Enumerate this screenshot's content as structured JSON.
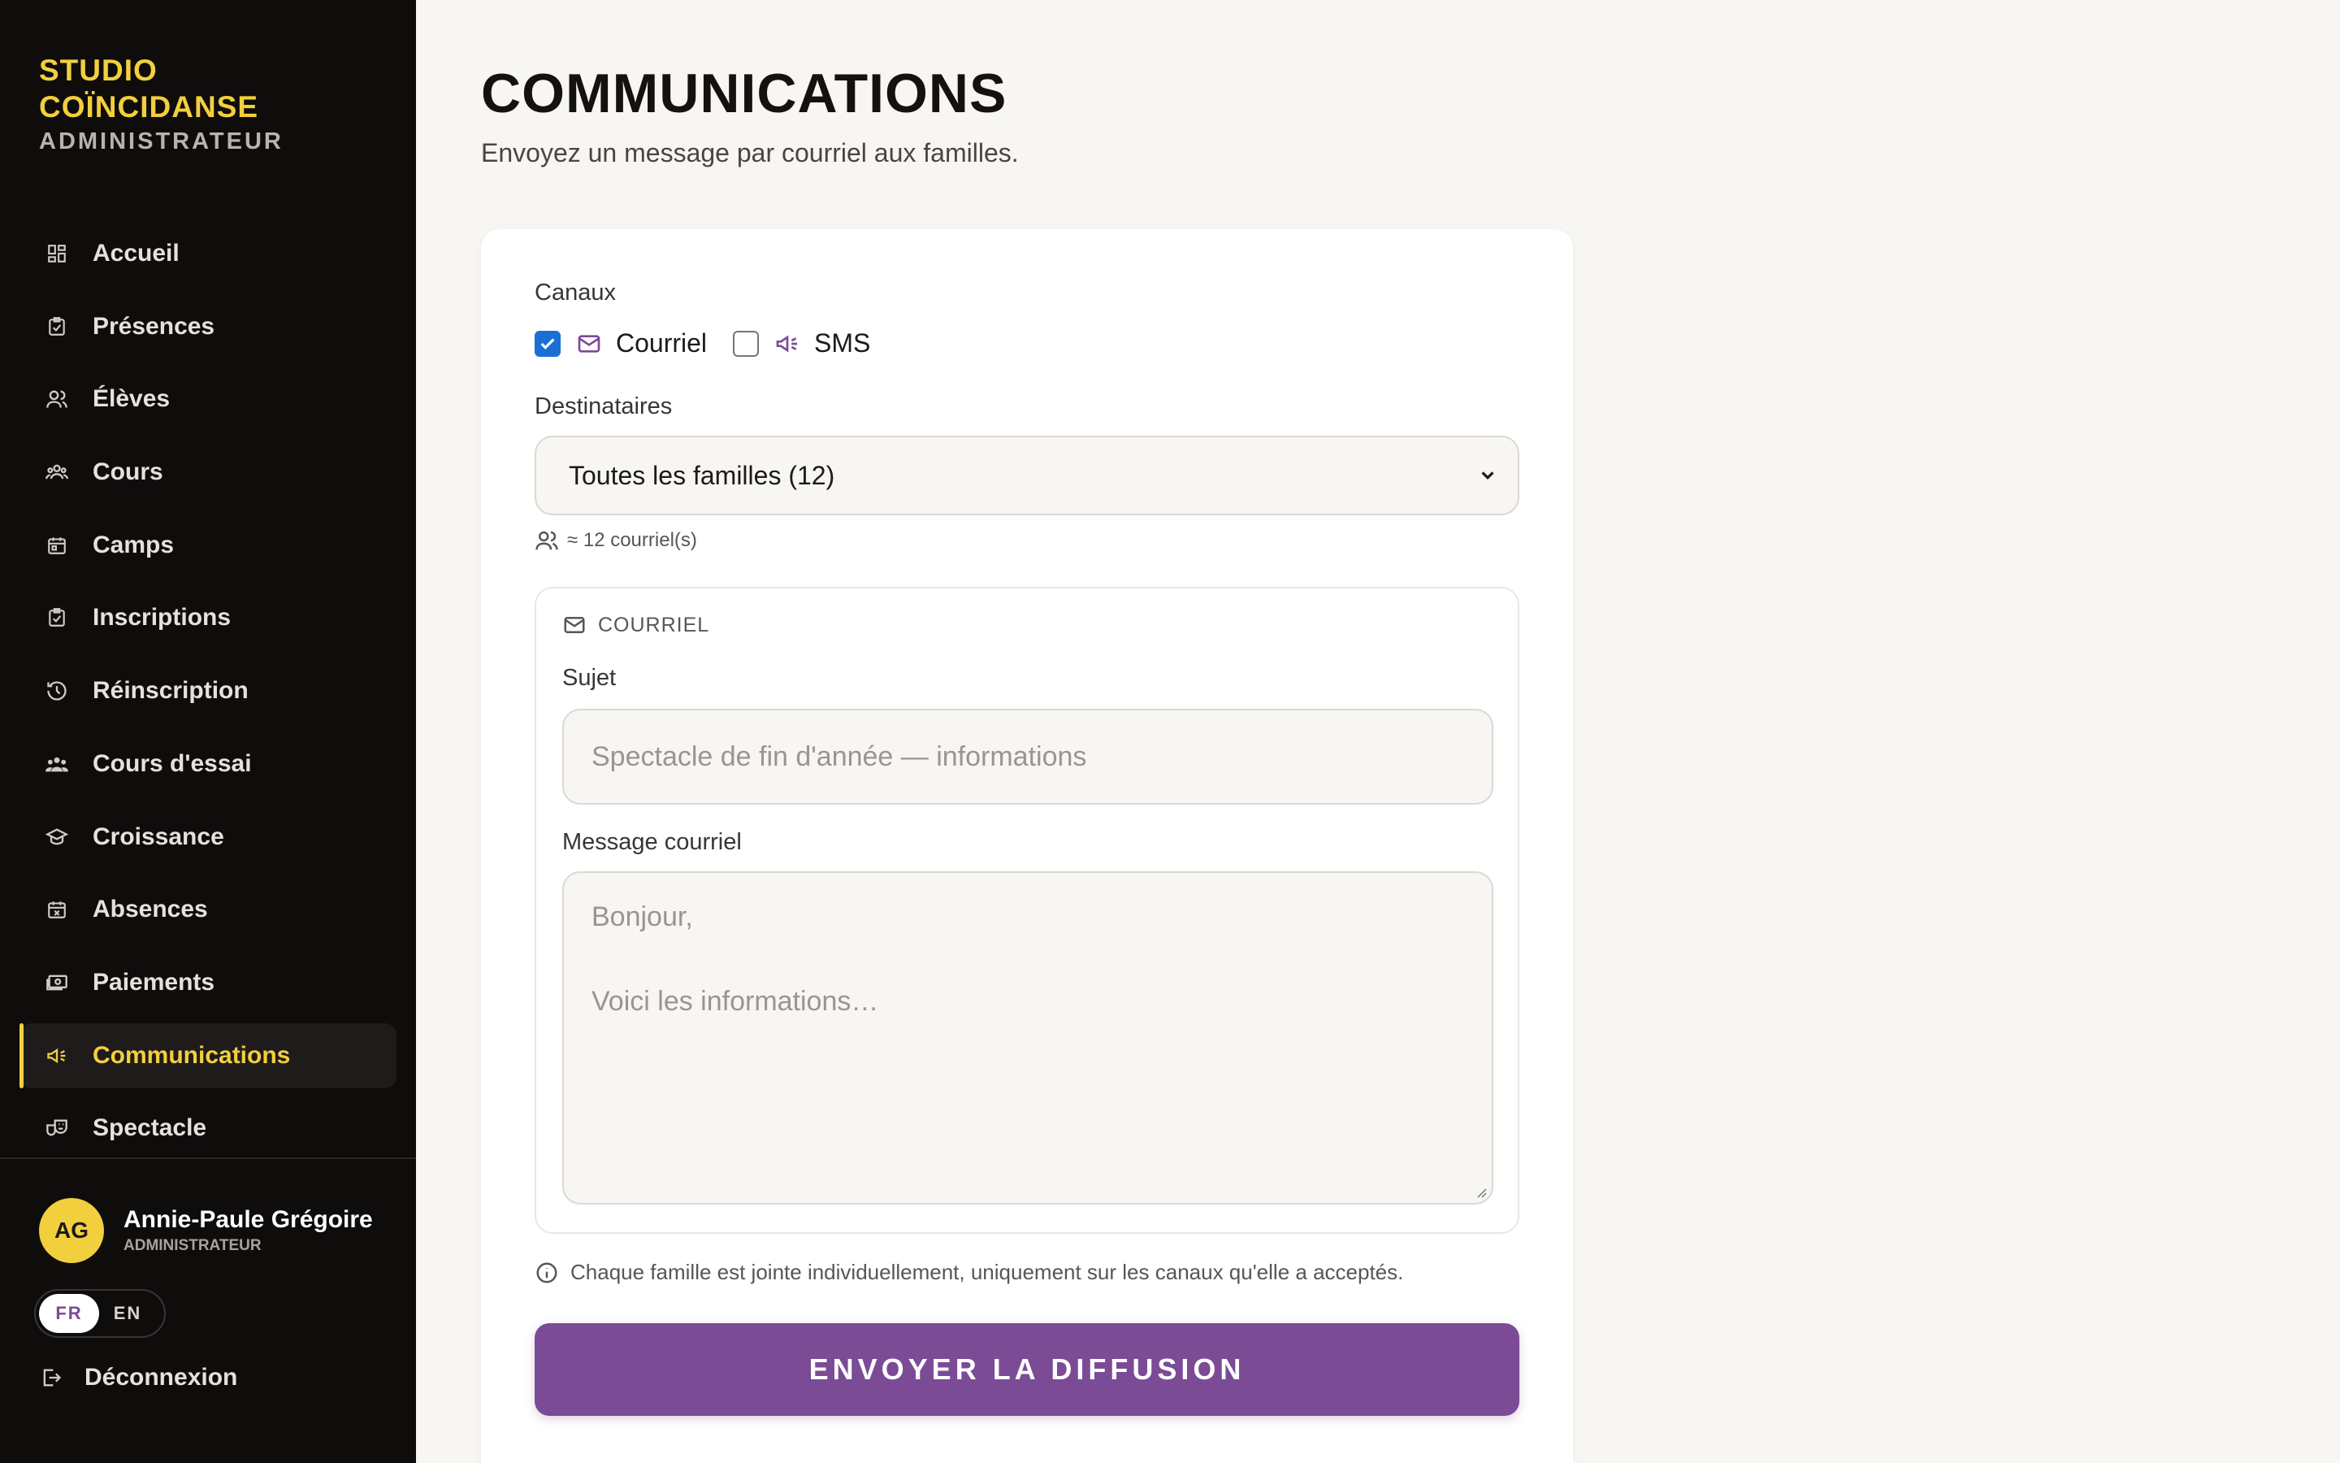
{
  "sidebar": {
    "brand_line1": "STUDIO",
    "brand_line2": "COÏNCIDANSE",
    "brand_role": "ADMINISTRATEUR",
    "items": [
      {
        "label": "Accueil",
        "icon": "dashboard-icon"
      },
      {
        "label": "Présences",
        "icon": "clipboard-check-icon"
      },
      {
        "label": "Élèves",
        "icon": "users-icon"
      },
      {
        "label": "Cours",
        "icon": "group-icon"
      },
      {
        "label": "Camps",
        "icon": "calendar-icon"
      },
      {
        "label": "Inscriptions",
        "icon": "clipboard-check-icon"
      },
      {
        "label": "Réinscription",
        "icon": "history-icon"
      },
      {
        "label": "Cours d'essai",
        "icon": "group-icon"
      },
      {
        "label": "Croissance",
        "icon": "graduation-cap-icon"
      },
      {
        "label": "Absences",
        "icon": "calendar-x-icon"
      },
      {
        "label": "Paiements",
        "icon": "money-icon"
      },
      {
        "label": "Communications",
        "icon": "megaphone-icon",
        "active": true
      },
      {
        "label": "Spectacle",
        "icon": "theater-masks-icon"
      }
    ],
    "user": {
      "initials": "AG",
      "name": "Annie-Paule Grégoire",
      "role": "ADMINISTRATEUR"
    },
    "lang": {
      "fr": "FR",
      "en": "EN",
      "active": "FR"
    },
    "logout": "Déconnexion"
  },
  "main": {
    "title": "COMMUNICATIONS",
    "subtitle": "Envoyez un message par courriel aux familles.",
    "channels": {
      "label": "Canaux",
      "email": {
        "label": "Courriel",
        "checked": true
      },
      "sms": {
        "label": "SMS",
        "checked": false
      }
    },
    "recipients": {
      "label": "Destinataires",
      "selected": "Toutes les familles (12)",
      "count": "≈ 12 courriel(s)"
    },
    "email": {
      "section_label": "COURRIEL",
      "subject_label": "Sujet",
      "subject_placeholder": "Spectacle de fin d'année — informations",
      "message_label": "Message courriel",
      "message_placeholder_line1": "Bonjour,",
      "message_placeholder_line2": "Voici les informations…"
    },
    "note": "Chaque famille est jointe individuellement, uniquement sur les canaux qu'elle a acceptés.",
    "send_button": "ENVOYER LA DIFFUSION"
  },
  "colors": {
    "sidebar_bg": "#0f0c0c",
    "accent_yellow": "#f2cf3d",
    "accent_purple": "#7b4b96",
    "page_bg": "#f8f6f2"
  }
}
